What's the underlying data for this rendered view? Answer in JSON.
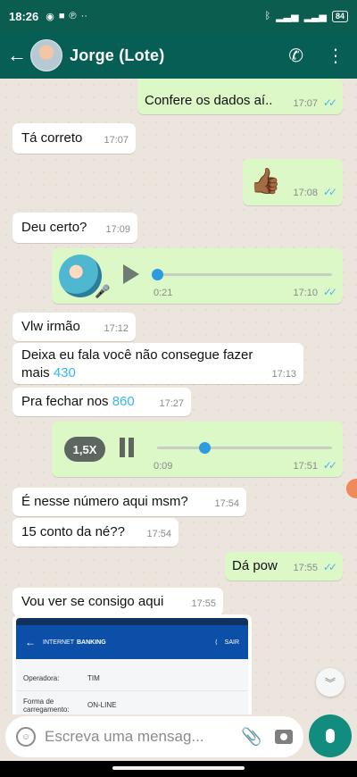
{
  "status_bar": {
    "time": "18:26",
    "battery": "84"
  },
  "header": {
    "contact_name": "Jorge (Lote)"
  },
  "messages": [
    {
      "type": "text",
      "dir": "out",
      "text": "Confere os dados aí..",
      "time": "17:07"
    },
    {
      "type": "text",
      "dir": "in",
      "text": "Tá correto",
      "time": "17:07"
    },
    {
      "type": "emoji",
      "dir": "out",
      "text": "👍🏾",
      "time": "17:08"
    },
    {
      "type": "text",
      "dir": "in",
      "text": "Deu certo?",
      "time": "17:09"
    },
    {
      "type": "audio",
      "dir": "out",
      "duration": "0:21",
      "time": "17:10",
      "progress": 0.0
    },
    {
      "type": "text",
      "dir": "in",
      "text": "Vlw irmão",
      "time": "17:12"
    },
    {
      "type": "text",
      "dir": "in",
      "text_before": "Deixa eu fala você não consegue fazer mais ",
      "link": "430",
      "time": "17:13"
    },
    {
      "type": "text",
      "dir": "in",
      "text_before": "Pra fechar nos ",
      "link": "860",
      "time": "17:27"
    },
    {
      "type": "audio",
      "dir": "out",
      "speed": "1,5X",
      "duration": "0:09",
      "time": "17:51",
      "progress": 0.27
    },
    {
      "type": "text",
      "dir": "in",
      "text": "É nesse número aqui msm?",
      "time": "17:54"
    },
    {
      "type": "text",
      "dir": "in",
      "text": "15 conto da né??",
      "time": "17:54"
    },
    {
      "type": "text",
      "dir": "out",
      "text": "Dá pow",
      "time": "17:55"
    },
    {
      "type": "text",
      "dir": "in",
      "text": "Vou ver se consigo aqui",
      "time": "17:55"
    }
  ],
  "image_attachment": {
    "app_title_1": "INTERNET",
    "app_title_2": "BANKING",
    "action": "SAIR",
    "rows": [
      {
        "label": "Operadora:",
        "value": "TIM"
      },
      {
        "label": "Forma de carregamento:",
        "value": "ON-LINE"
      }
    ]
  },
  "composer": {
    "placeholder": "Escreva uma mensag..."
  },
  "colors": {
    "header": "#075e54",
    "incoming": "#ffffff",
    "outgoing": "#dcf8c6",
    "read_ticks": "#4fb6ec",
    "link": "#34b7f1",
    "fab": "#128c7e"
  }
}
